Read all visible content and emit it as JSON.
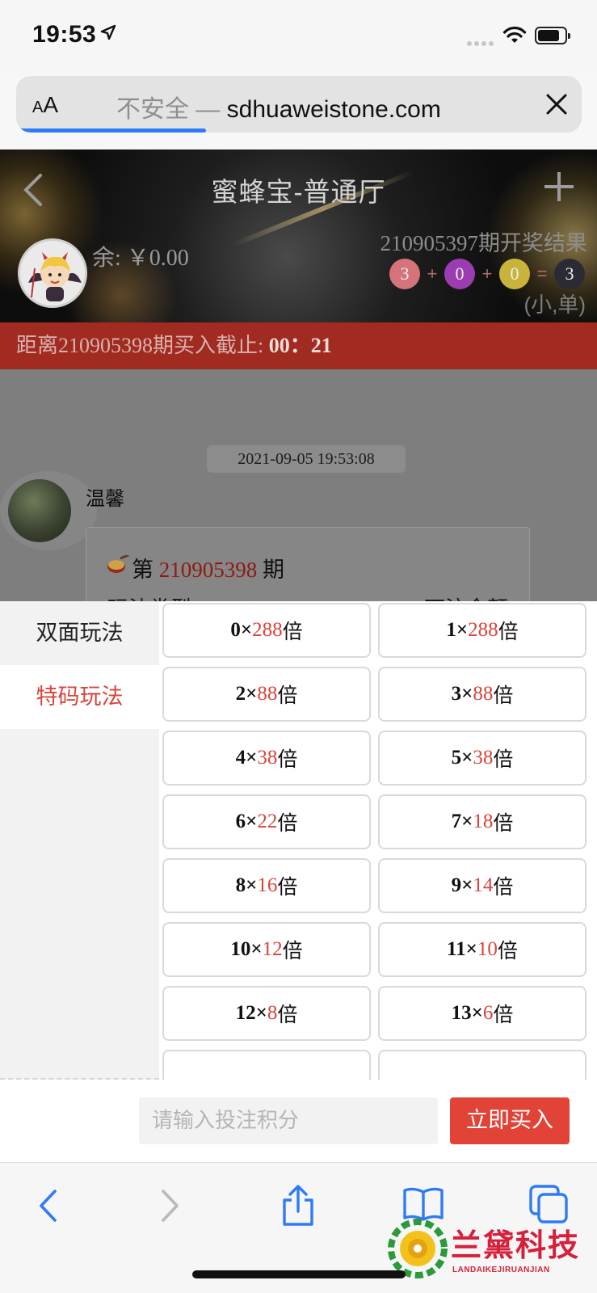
{
  "status": {
    "time": "19:53"
  },
  "browser": {
    "aa": "AA",
    "insecure": "不安全",
    "sep": " — ",
    "domain": "sdhuaweistone.com",
    "load_progress": 0.33
  },
  "header": {
    "title": "蜜蜂宝-普通厅",
    "balance": "余: ￥0.00",
    "last_result": {
      "label": "210905397期开奖结果",
      "balls": [
        "3",
        "0",
        "0",
        "3"
      ],
      "ops": [
        "+",
        "+",
        "="
      ],
      "ball_colors": [
        "#d4737a",
        "#9b3db0",
        "#c8b43a",
        "#2b2b36"
      ],
      "summary": "(小,单)"
    }
  },
  "countdown": {
    "prefix": "距离210905398期买入截止: ",
    "time": "00：21"
  },
  "chat": {
    "timestamp": "2021-09-05 19:53:08",
    "user": "温馨",
    "period_prefix": "第 ",
    "period_number": "210905398",
    "period_suffix": " 期",
    "col_left": "玩法类型",
    "col_right": "下注金额"
  },
  "sheet": {
    "tabs": [
      "双面玩法",
      "特码玩法"
    ],
    "active_tab": 1,
    "odds": [
      {
        "num": "0",
        "times": "288",
        "unit": "倍"
      },
      {
        "num": "1",
        "times": "288",
        "unit": "倍"
      },
      {
        "num": "2",
        "times": "88",
        "unit": "倍"
      },
      {
        "num": "3",
        "times": "88",
        "unit": "倍"
      },
      {
        "num": "4",
        "times": "38",
        "unit": "倍"
      },
      {
        "num": "5",
        "times": "38",
        "unit": "倍"
      },
      {
        "num": "6",
        "times": "22",
        "unit": "倍"
      },
      {
        "num": "7",
        "times": "18",
        "unit": "倍"
      },
      {
        "num": "8",
        "times": "16",
        "unit": "倍"
      },
      {
        "num": "9",
        "times": "14",
        "unit": "倍"
      },
      {
        "num": "10",
        "times": "12",
        "unit": "倍"
      },
      {
        "num": "11",
        "times": "10",
        "unit": "倍"
      },
      {
        "num": "12",
        "times": "8",
        "unit": "倍"
      },
      {
        "num": "13",
        "times": "6",
        "unit": "倍"
      }
    ],
    "times_sign": "×"
  },
  "buy": {
    "placeholder": "请输入投注积分",
    "button": "立即买入"
  },
  "toolbar_icons": [
    "back-icon",
    "forward-icon",
    "share-icon",
    "bookmarks-icon",
    "tabs-icon"
  ],
  "watermark": {
    "name": "兰黛科技",
    "pinyin": "LANDAIKEJIRUANJIAN"
  }
}
